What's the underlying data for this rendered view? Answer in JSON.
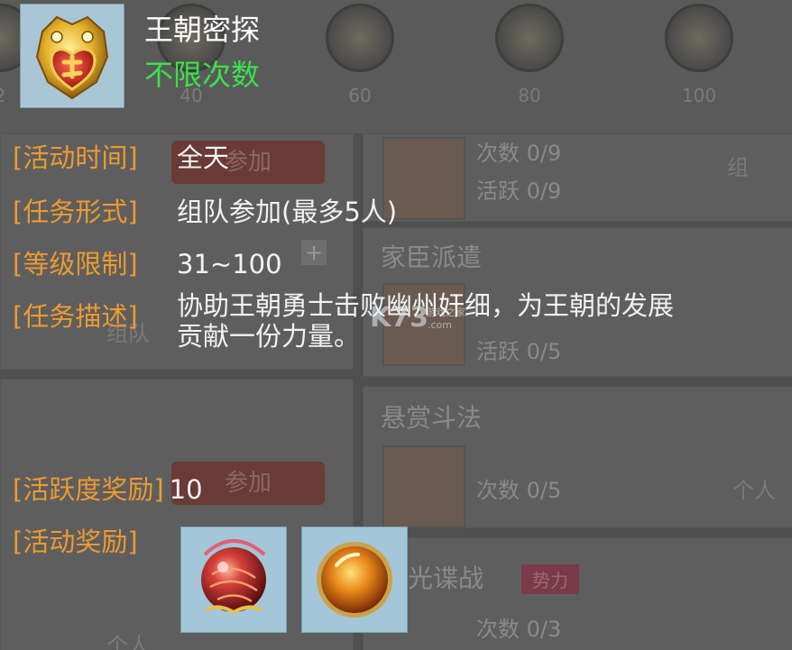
{
  "background": {
    "milestones": [
      {
        "value": "2"
      },
      {
        "value": "40"
      },
      {
        "value": "60"
      },
      {
        "value": "80"
      },
      {
        "value": "100"
      }
    ],
    "cards": [
      {
        "title": "",
        "stats": [
          "次数 0/9",
          "活跃 0/9"
        ]
      },
      {
        "title": "家臣派遣",
        "stats": [
          "活跃 0/5"
        ]
      },
      {
        "title": "悬赏斗法",
        "stats": [
          "次数 0/5"
        ]
      },
      {
        "title": "光谍战",
        "stats": [
          "次数 0/3"
        ],
        "tag": "势力"
      }
    ],
    "left_buttons": [
      "参加",
      "参加"
    ],
    "side_labels": [
      "组队",
      "个人",
      "组",
      "个人"
    ]
  },
  "tooltip": {
    "icon": "golden-beast-badge-icon",
    "title": "王朝密探",
    "subtitle": "不限次数",
    "rows": [
      {
        "label": "[活动时间]",
        "value": "全天"
      },
      {
        "label": "[任务形式]",
        "value": "组队参加(最多5人)"
      },
      {
        "label": "[等级限制]",
        "value": "31~100"
      },
      {
        "label": "[任务描述]",
        "value": ""
      }
    ],
    "description_line1": "协助王朝勇士击败幽州奸细，为王朝的发展",
    "description_line2": "贡献一份力量。",
    "activity_reward_label": "[活跃度奖励]",
    "activity_reward_value": "10",
    "reward_label": "[活动奖励]",
    "rewards": [
      {
        "icon": "red-swirl-orb-icon"
      },
      {
        "icon": "amber-orb-icon"
      }
    ],
    "watermark": "K73 游戏之家 .com"
  },
  "colors": {
    "accent_orange": "#ec9a32",
    "status_green": "#39e34a",
    "text_white": "#f2f2f2"
  }
}
